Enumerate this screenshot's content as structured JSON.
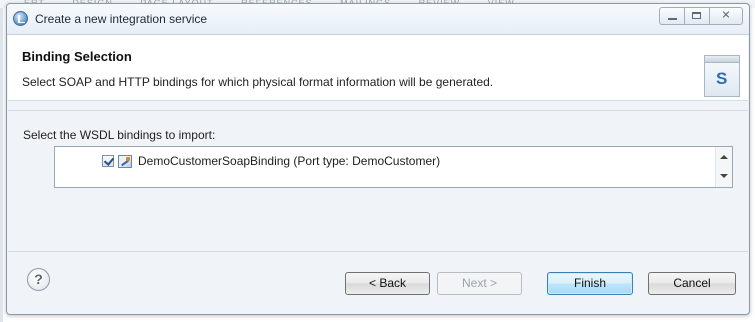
{
  "background": {
    "menu_items": [
      "ERT",
      "DESIGN",
      "PAGE LAYOUT",
      "REFERENCES",
      "MAILINGS",
      "REVIEW",
      "VIEW"
    ]
  },
  "dialog": {
    "title": "Create a new integration service",
    "window_controls": {
      "minimize_icon": "minimize-icon",
      "maximize_icon": "maximize-icon",
      "close_icon": "close-icon",
      "close_glyph": "✕"
    }
  },
  "banner": {
    "title": "Binding Selection",
    "description": "Select SOAP and HTTP bindings for which physical format information will be generated.",
    "icon_letter": "S"
  },
  "bindings": {
    "label": "Select the WSDL bindings to import:",
    "items": [
      {
        "label": "DemoCustomerSoapBinding (Port type: DemoCustomer)",
        "checked": true,
        "icon": "binding-icon"
      }
    ]
  },
  "footer": {
    "help_label": "?",
    "back_label": "< Back",
    "next_label": "Next >",
    "finish_label": "Finish",
    "cancel_label": "Cancel",
    "next_enabled": false
  },
  "colors": {
    "default_button_border": "#3c7fb1",
    "dialog_background": "#eef3f9"
  }
}
